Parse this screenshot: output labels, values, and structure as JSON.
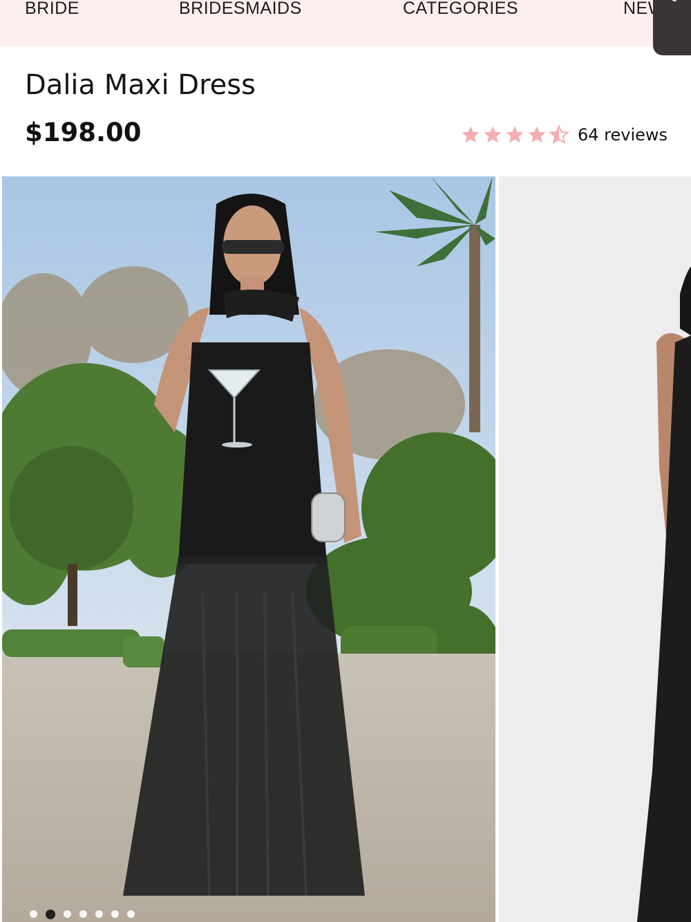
{
  "nav": {
    "items": [
      "BRIDE",
      "BRIDESMAIDS",
      "CATEGORIES",
      "NEW"
    ]
  },
  "product": {
    "title": "Dalia Maxi Dress",
    "price": "$198.00",
    "rating": 4.5,
    "reviews_label": "64 reviews"
  },
  "gallery": {
    "image_count": 7,
    "active_index": 1
  },
  "colors": {
    "nav_bg": "#fcefee",
    "star": "#f4aeb0",
    "text": "#111111"
  }
}
